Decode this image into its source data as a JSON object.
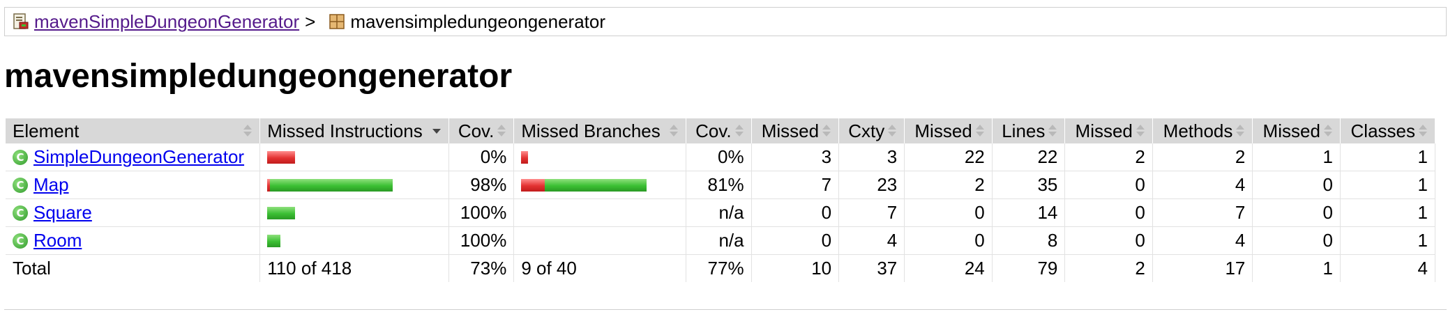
{
  "breadcrumb": {
    "root_label": "mavenSimpleDungeonGenerator",
    "separator": ">",
    "current_label": "mavensimpledungeongenerator",
    "root_icon": "report-icon",
    "package_icon": "package-icon"
  },
  "title": "mavensimpledungeongenerator",
  "table": {
    "headers": [
      "Element",
      "Missed Instructions",
      "Cov.",
      "Missed Branches",
      "Cov.",
      "Missed",
      "Cxty",
      "Missed",
      "Lines",
      "Missed",
      "Methods",
      "Missed",
      "Classes"
    ],
    "sorted_column": "Missed Instructions",
    "rows": [
      {
        "name": "SimpleDungeonGenerator",
        "instr_missed_fraction": 1.0,
        "instr_total": 60,
        "instr_cov": "0%",
        "branch_missed_fraction": 1.0,
        "branch_total": 2,
        "branch_cov": "0%",
        "cxty_missed": "3",
        "cxty": "3",
        "lines_missed": "22",
        "lines": "22",
        "methods_missed": "2",
        "methods": "2",
        "classes_missed": "1",
        "classes": "1"
      },
      {
        "name": "Map",
        "instr_missed_fraction": 0.02,
        "instr_total": 270,
        "instr_cov": "98%",
        "branch_missed_fraction": 0.19,
        "branch_total": 38,
        "branch_cov": "81%",
        "cxty_missed": "7",
        "cxty": "23",
        "lines_missed": "2",
        "lines": "35",
        "methods_missed": "0",
        "methods": "4",
        "classes_missed": "0",
        "classes": "1"
      },
      {
        "name": "Square",
        "instr_missed_fraction": 0.0,
        "instr_total": 60,
        "instr_cov": "100%",
        "branch_missed_fraction": null,
        "branch_total": 0,
        "branch_cov": "n/a",
        "cxty_missed": "0",
        "cxty": "7",
        "lines_missed": "0",
        "lines": "14",
        "methods_missed": "0",
        "methods": "7",
        "classes_missed": "0",
        "classes": "1"
      },
      {
        "name": "Room",
        "instr_missed_fraction": 0.0,
        "instr_total": 28,
        "instr_cov": "100%",
        "branch_missed_fraction": null,
        "branch_total": 0,
        "branch_cov": "n/a",
        "cxty_missed": "0",
        "cxty": "4",
        "lines_missed": "0",
        "lines": "8",
        "methods_missed": "0",
        "methods": "4",
        "classes_missed": "0",
        "classes": "1"
      }
    ],
    "total": {
      "label": "Total",
      "instr": "110 of 418",
      "instr_cov": "73%",
      "branch": "9 of 40",
      "branch_cov": "77%",
      "cxty_missed": "10",
      "cxty": "37",
      "lines_missed": "24",
      "lines": "79",
      "methods_missed": "2",
      "methods": "17",
      "classes_missed": "1",
      "classes": "4"
    }
  },
  "colors": {
    "missed_bar": "#e33232",
    "covered_bar": "#3bbf33",
    "header_bg": "#d8d8d8"
  }
}
